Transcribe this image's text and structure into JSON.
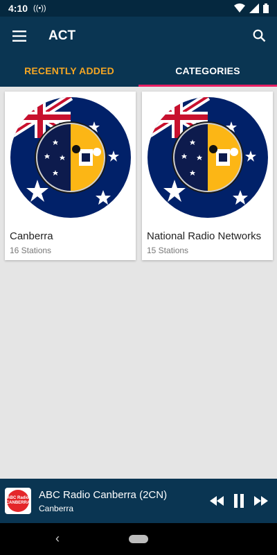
{
  "status": {
    "time": "4:10",
    "cast": "((•))"
  },
  "app": {
    "title": "ACT"
  },
  "tabs": [
    {
      "label": "RECENTLY ADDED"
    },
    {
      "label": "CATEGORIES"
    }
  ],
  "categories": [
    {
      "name": "Canberra",
      "count": "16 Stations"
    },
    {
      "name": "National Radio Networks",
      "count": "15 Stations"
    }
  ],
  "player": {
    "title": "ABC Radio Canberra (2CN)",
    "subtitle": "Canberra",
    "logo_line1": "ABC Radio",
    "logo_line2": "CANBERRA"
  },
  "colors": {
    "app_bar": "#0a3552",
    "status_bar": "#05283f",
    "accent_orange": "#f5a623",
    "tab_indicator": "#e91e63",
    "flag_blue": "#012169",
    "act_yellow": "#fcb615"
  }
}
